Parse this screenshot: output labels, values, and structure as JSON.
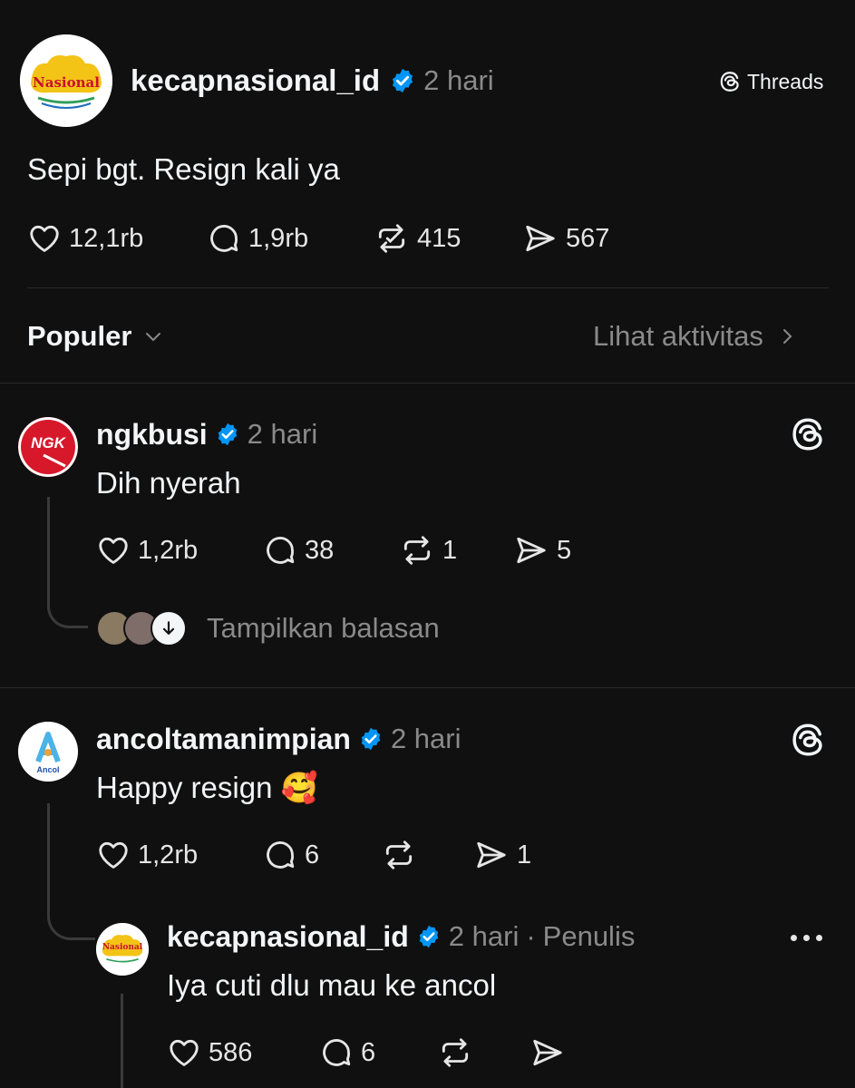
{
  "post": {
    "username": "kecapnasional_id",
    "time": "2 hari",
    "avatar_text": "Nasional",
    "text": "Sepi bgt. Resign kali ya",
    "threads_badge": "Threads",
    "stats": {
      "likes": "12,1rb",
      "replies": "1,9rb",
      "reposts": "415",
      "shares": "567"
    }
  },
  "sort": {
    "label": "Populer",
    "activity": "Lihat aktivitas"
  },
  "comments": [
    {
      "username": "ngkbusi",
      "time": "2 hari",
      "avatar_text": "NGK",
      "text": "Dih nyerah",
      "stats": {
        "likes": "1,2rb",
        "replies": "38",
        "reposts": "1",
        "shares": "5"
      },
      "show_replies": "Tampilkan balasan"
    },
    {
      "username": "ancoltamanimpian",
      "time": "2 hari",
      "avatar_text": "Ancol",
      "text": "Happy resign 🥰",
      "stats": {
        "likes": "1,2rb",
        "replies": "6",
        "shares": "1"
      }
    }
  ],
  "reply": {
    "username": "kecapnasional_id",
    "time": "2 hari",
    "author_tag": "Penulis",
    "avatar_text": "Nasional",
    "text": "Iya cuti dlu mau ke ancol",
    "stats": {
      "likes": "586",
      "replies": "6"
    }
  },
  "colors": {
    "background": "#101010",
    "verified": "#0095f6",
    "muted": "#8a8a8a"
  }
}
